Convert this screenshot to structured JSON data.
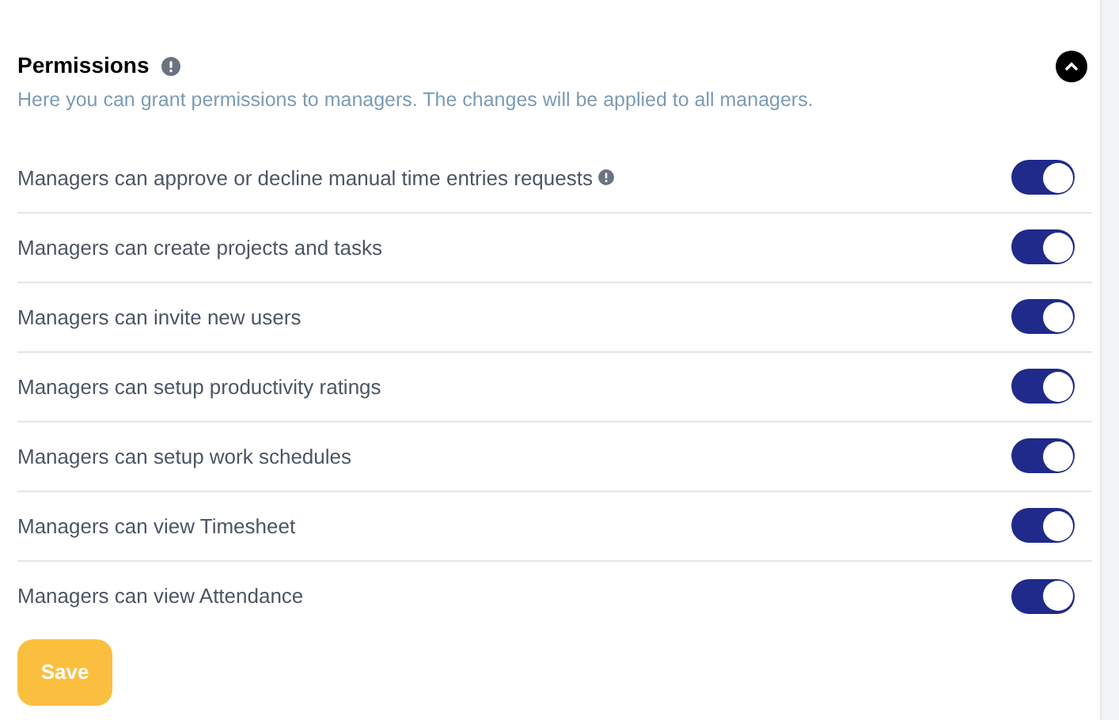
{
  "section": {
    "title": "Permissions",
    "description": "Here you can grant permissions to managers. The changes will be applied to all managers.",
    "expanded": true
  },
  "permissions": [
    {
      "label": "Managers can approve or decline manual time entries requests",
      "info": true,
      "on": true
    },
    {
      "label": "Managers can create projects and tasks",
      "info": false,
      "on": true
    },
    {
      "label": "Managers can invite new users",
      "info": false,
      "on": true
    },
    {
      "label": "Managers can setup productivity ratings",
      "info": false,
      "on": true
    },
    {
      "label": "Managers can setup work schedules",
      "info": false,
      "on": true
    },
    {
      "label": "Managers can view Timesheet",
      "info": false,
      "on": true
    },
    {
      "label": "Managers can view Attendance",
      "info": false,
      "on": true
    }
  ],
  "save_button": "Save"
}
